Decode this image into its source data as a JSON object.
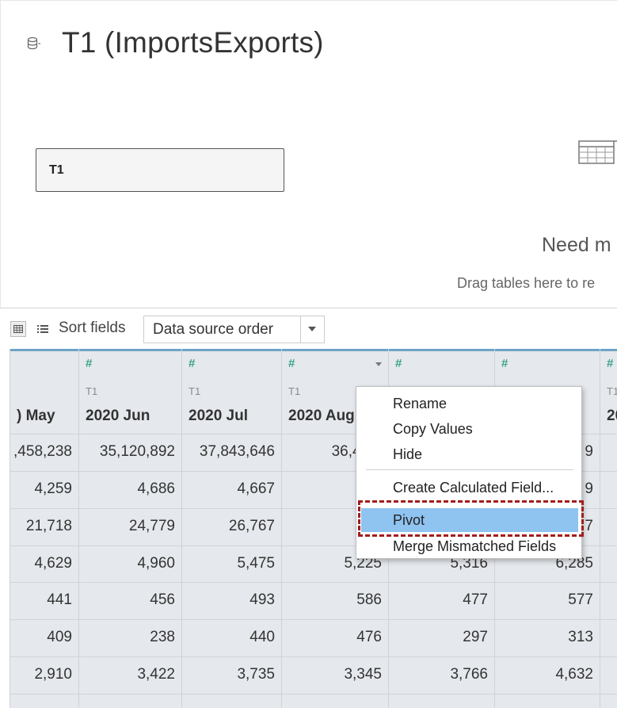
{
  "header": {
    "title": "T1 (ImportsExports)",
    "table_chip": "T1",
    "need_more": "Need m",
    "drag_hint": "Drag tables here to re"
  },
  "toolbar": {
    "sort_label": "Sort fields",
    "sort_value": "Data source order"
  },
  "grid": {
    "type_icon": "#",
    "columns": [
      {
        "name": ") May",
        "source": "",
        "type": ""
      },
      {
        "name": "2020 Jun",
        "source": "T1",
        "type": "#"
      },
      {
        "name": "2020 Jul",
        "source": "T1",
        "type": "#"
      },
      {
        "name": "2020 Aug",
        "source": "T1",
        "type": "#"
      },
      {
        "name": "",
        "source": "",
        "type": "#"
      },
      {
        "name": "",
        "source": "",
        "type": "#"
      },
      {
        "name": "20",
        "source": "T1",
        "type": "#"
      }
    ],
    "rows": [
      [
        ",458,238",
        "35,120,892",
        "37,843,646",
        "36,472,",
        "",
        "9",
        ""
      ],
      [
        "4,259",
        "4,686",
        "4,667",
        "4,",
        "",
        "9",
        ""
      ],
      [
        "21,718",
        "24,779",
        "26,767",
        "26,",
        "",
        "7",
        ""
      ],
      [
        "4,629",
        "4,960",
        "5,475",
        "5,225",
        "5,316",
        "6,285",
        ""
      ],
      [
        "441",
        "456",
        "493",
        "586",
        "477",
        "577",
        ""
      ],
      [
        "409",
        "238",
        "440",
        "476",
        "297",
        "313",
        ""
      ],
      [
        "2,910",
        "3,422",
        "3,735",
        "3,345",
        "3,766",
        "4,632",
        ""
      ]
    ]
  },
  "context_menu": {
    "items": [
      "Rename",
      "Copy Values",
      "Hide",
      "Create Calculated Field...",
      "Pivot",
      "Merge Mismatched Fields"
    ],
    "highlighted": "Pivot",
    "highlight_color": "#8fc3f0",
    "callout_color": "#a31c1c"
  },
  "colors": {
    "accent": "#6ea4c6",
    "measure_icon": "#3aa28c",
    "grid_bg": "#e5e8ec"
  }
}
